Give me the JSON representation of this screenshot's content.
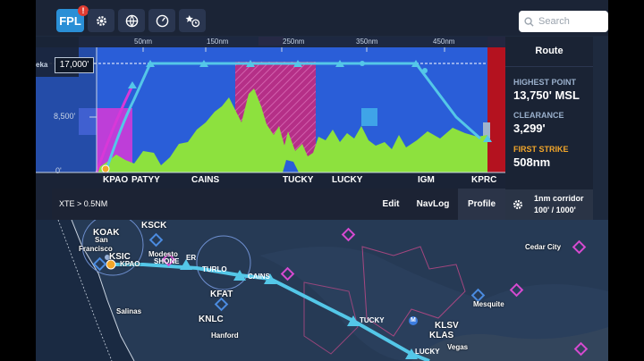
{
  "toolbar": {
    "fpl_label": "FPL",
    "fpl_badge": "!",
    "search_placeholder": "Search",
    "icons": [
      "gear-icon",
      "globe-icon",
      "gauge-icon",
      "star-clock-icon",
      "search-icon"
    ]
  },
  "profile": {
    "altitude_box": "17,000'",
    "left_edge_label": "eka",
    "alt_ticks": [
      "8,500'",
      "0'"
    ],
    "distance_ticks": [
      "50nm",
      "150nm",
      "250nm",
      "350nm",
      "450nm"
    ],
    "waypoints": [
      "KPAO",
      "PATYY",
      "CAINS",
      "TUCKY",
      "LUCKY",
      "IGM",
      "KPRC"
    ],
    "tabs": {
      "xte": "XTE > 0.5NM",
      "edit": "Edit",
      "navlog": "NavLog",
      "profile": "Profile"
    }
  },
  "side_panel": {
    "title": "Route",
    "highest_label": "HIGHEST POINT",
    "highest_value": "13,750' MSL",
    "clearance_label": "CLEARANCE",
    "clearance_value": "3,299'",
    "strike_label": "FIRST STRIKE",
    "strike_value": "508nm",
    "corridor_line1": "1nm corridor",
    "corridor_line2": "100' / 1000'"
  },
  "map": {
    "airports": [
      "KOAK",
      "KSCK",
      "KSIC",
      "KPAO",
      "KFAT",
      "KNLC",
      "KLSV",
      "KLAS"
    ],
    "cities": [
      "Francisco",
      "Modesto",
      "Salinas",
      "Hanford",
      "Mesquite",
      "Cedar City",
      "Vegas"
    ],
    "route_labels": [
      "TURLO",
      "CAINS",
      "TUCKY",
      "LUCKY",
      "SHONE",
      "ER"
    ],
    "fragment_labels": [
      "San"
    ],
    "marker": "M"
  },
  "colors": {
    "terrain_green": "#8de13e",
    "sky_blue": "#2a5ed8",
    "restricted_magenta": "#d6389a",
    "route_cyan": "#54c7e8",
    "fpl_blue": "#2a8fd6",
    "strike_orange": "#f2a62a",
    "warning_red": "#b4121f"
  }
}
